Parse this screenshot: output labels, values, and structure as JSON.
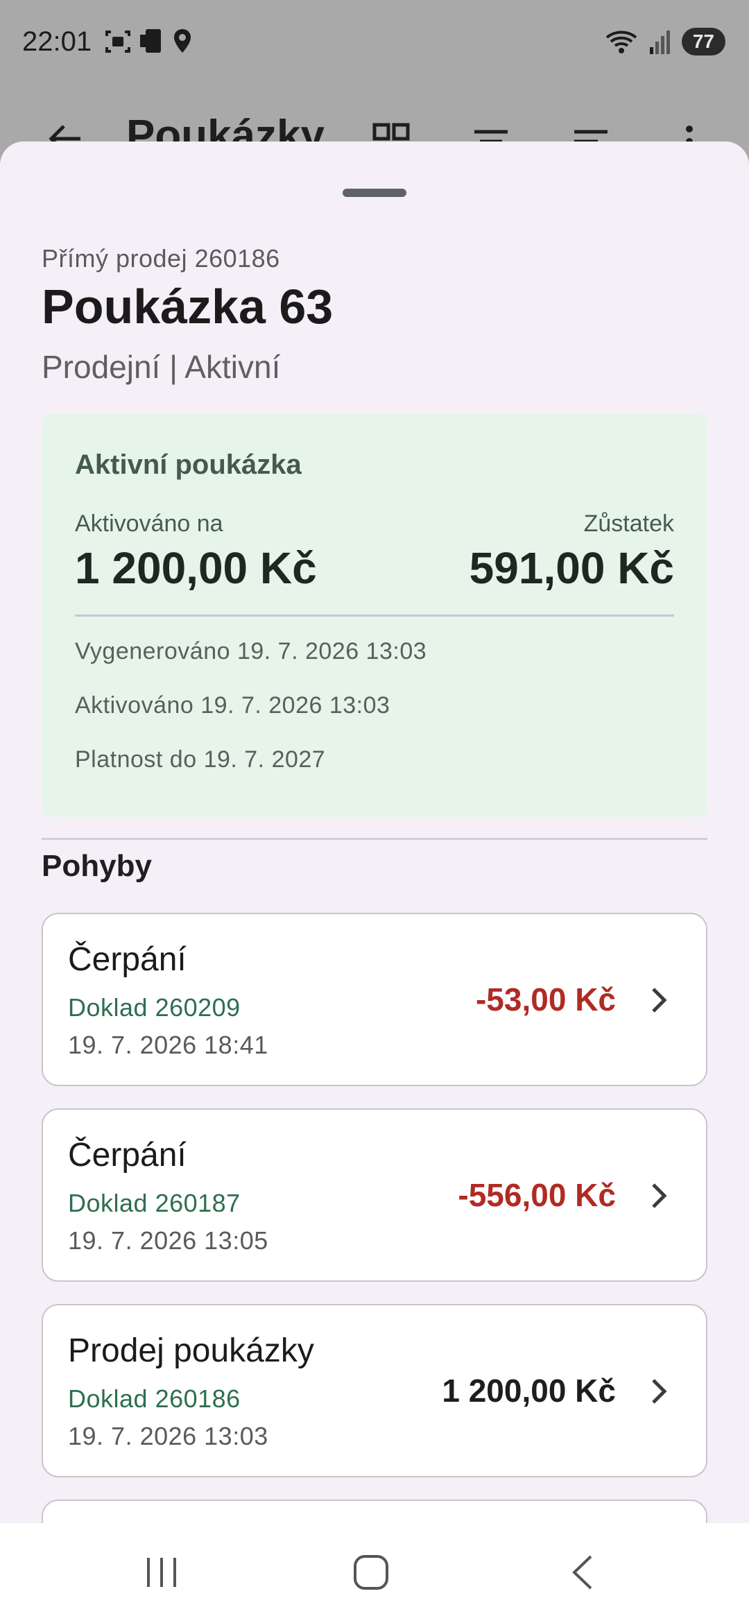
{
  "status_bar": {
    "time": "22:01",
    "battery": "77",
    "icons_left": [
      "screenshot-icon",
      "phone-icon",
      "location-icon"
    ],
    "icons_right": [
      "wifi-icon",
      "signal-icon",
      "battery-icon"
    ]
  },
  "app_bar": {
    "title": "Poukázky",
    "icons": [
      "back-arrow-icon",
      "qr-code-icon",
      "filter-icon",
      "sort-icon",
      "more-vert-icon"
    ]
  },
  "sheet": {
    "subhead": "Přímý prodej 260186",
    "title": "Poukázka 63",
    "status_line": "Prodejní | Aktivní",
    "active_card": {
      "heading": "Aktivní poukázka",
      "activated_label": "Aktivováno na",
      "activated_value": "1 200,00 Kč",
      "balance_label": "Zůstatek",
      "balance_value": "591,00 Kč",
      "generated": "Vygenerováno 19. 7. 2026 13:03",
      "activated": "Aktivováno 19. 7. 2026 13:03",
      "valid_until": "Platnost do 19. 7. 2027"
    },
    "movements_title": "Pohyby",
    "movements": [
      {
        "title": "Čerpání",
        "doc": "Doklad 260209",
        "date": "19. 7. 2026 18:41",
        "amount": "-53,00 Kč",
        "negative": true
      },
      {
        "title": "Čerpání",
        "doc": "Doklad 260187",
        "date": "19. 7. 2026 13:05",
        "amount": "-556,00 Kč",
        "negative": true
      },
      {
        "title": "Prodej poukázky",
        "doc": "Doklad 260186",
        "date": "19. 7. 2026 13:03",
        "amount": "1 200,00 Kč",
        "negative": false
      }
    ]
  },
  "nav_bar": {
    "buttons": [
      "recents-icon",
      "home-icon",
      "back-icon"
    ]
  },
  "colors": {
    "sheet_bg": "#f5f0f8",
    "active_card_bg": "#e7f4ea",
    "negative": "#b02b23",
    "doc_green": "#2e6e51"
  }
}
